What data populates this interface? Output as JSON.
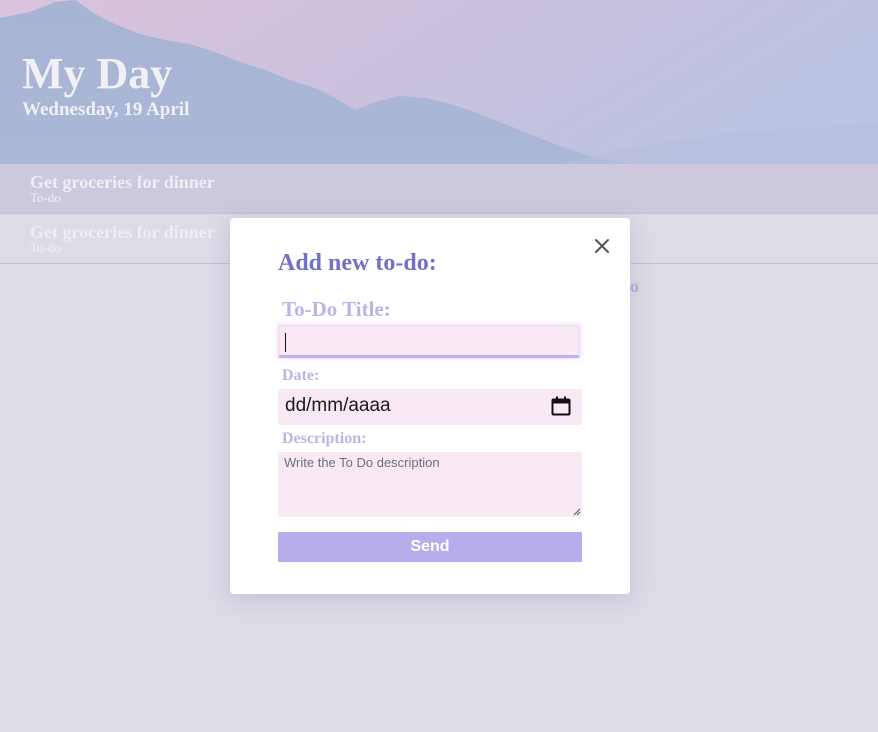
{
  "header": {
    "title": "My Day",
    "date": "Wednesday, 19 April"
  },
  "todos": [
    {
      "title": "Get groceries for dinner",
      "status": "To-do"
    },
    {
      "title": "Get groceries for dinner",
      "status": "To-do"
    }
  ],
  "background_add_label": "o",
  "modal": {
    "heading": "Add new to-do:",
    "close_icon": "close-icon",
    "title_label": "To-Do Title:",
    "title_value": "",
    "date_label": "Date:",
    "date_placeholder": "dd/mm/aaaa",
    "calendar_icon": "calendar-icon",
    "description_label": "Description:",
    "description_placeholder": "Write the To Do description",
    "send_label": "Send"
  },
  "colors": {
    "accent": "#7171c8",
    "label": "#bcb3e6",
    "input_bg": "#f8e9f5",
    "button_bg": "#b6aeec",
    "overlay": "#dcdbe6"
  }
}
